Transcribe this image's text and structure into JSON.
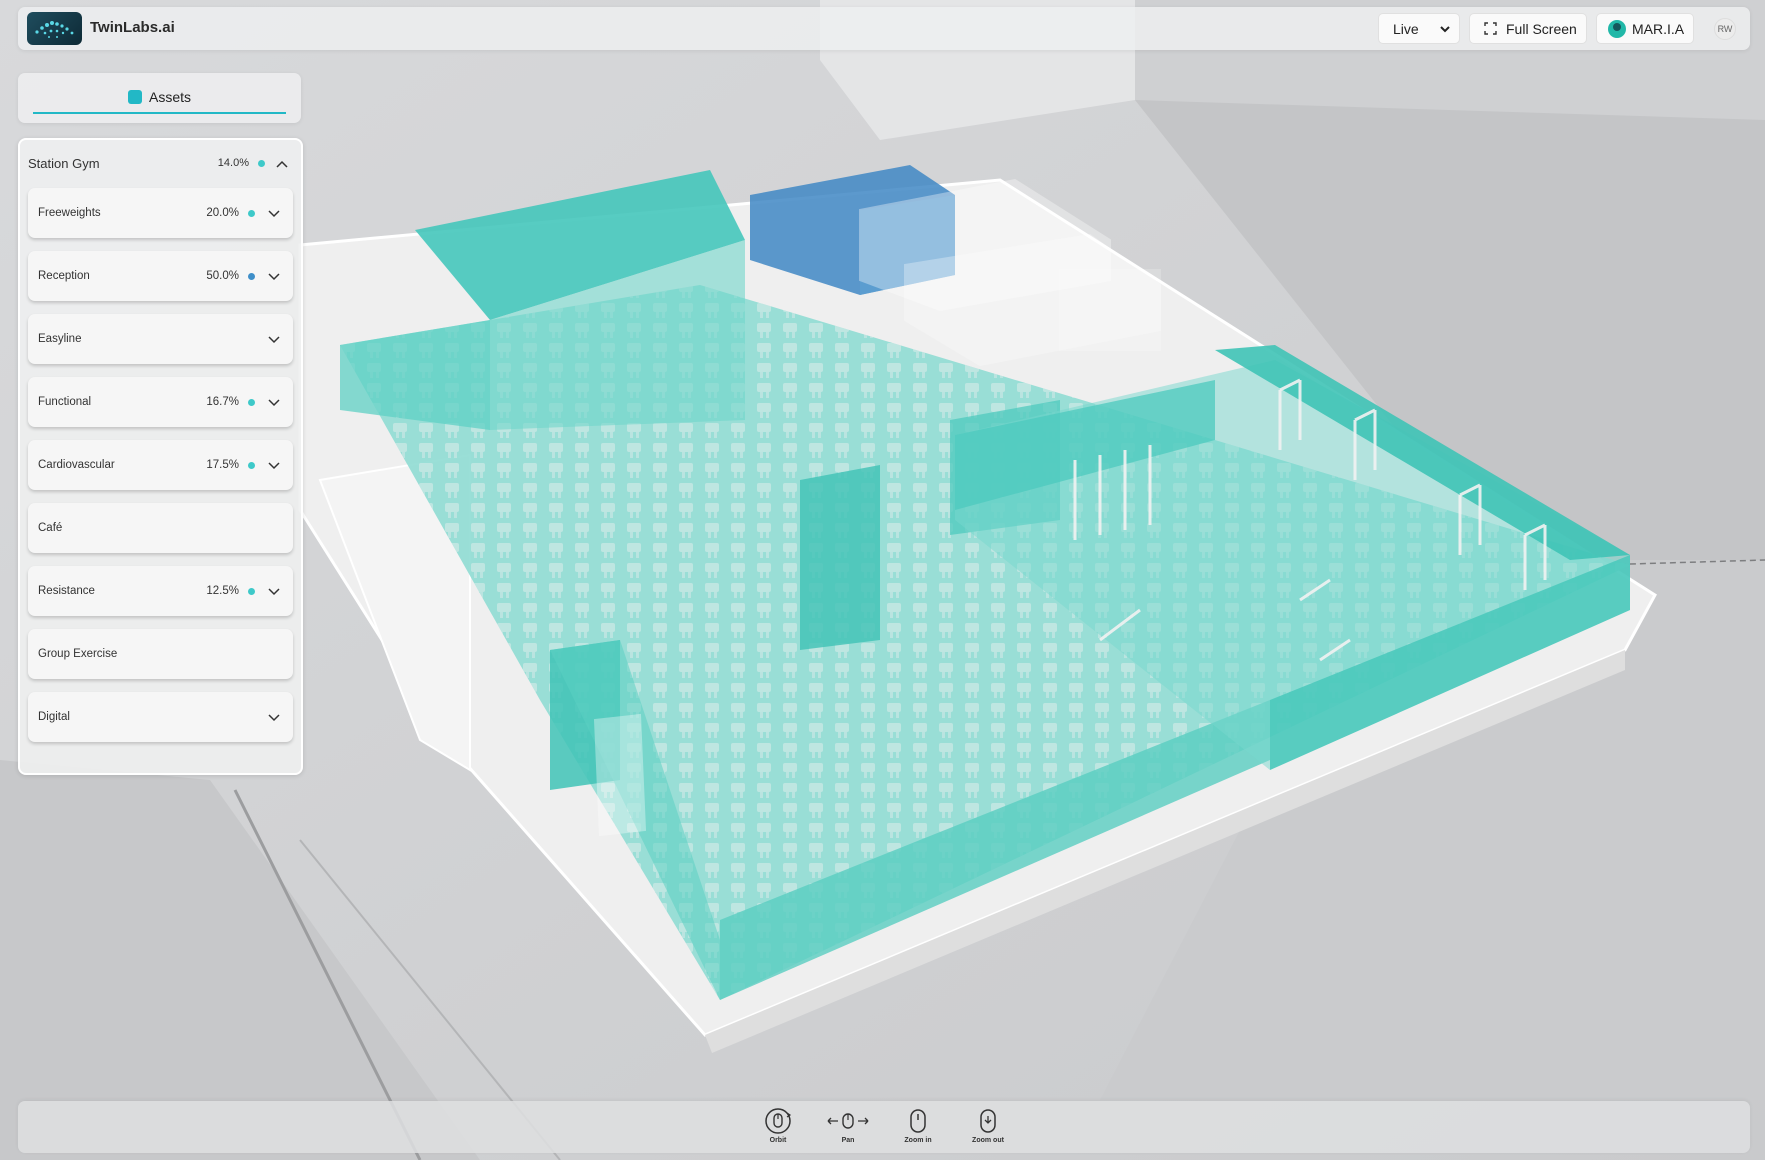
{
  "header": {
    "brand": "TwinLabs.ai",
    "view_mode": "Live",
    "fullscreen_label": "Full Screen",
    "user_label": "MAR.I.A",
    "user_initials": "RW"
  },
  "assets_tab": {
    "label": "Assets"
  },
  "panel": {
    "title": "Station Gym",
    "percent": "14.0%",
    "zones": [
      {
        "name": "Freeweights",
        "percent": "20.0%"
      },
      {
        "name": "Reception",
        "percent": "50.0%"
      },
      {
        "name": "Easyline",
        "percent": ""
      },
      {
        "name": "Functional",
        "percent": "16.7%"
      },
      {
        "name": "Cardiovascular",
        "percent": "17.5%"
      },
      {
        "name": "Café",
        "percent": ""
      },
      {
        "name": "Resistance",
        "percent": "12.5%"
      },
      {
        "name": "Group Exercise",
        "percent": ""
      },
      {
        "name": "Digital",
        "percent": ""
      }
    ]
  },
  "controls": {
    "orbit": "Orbit",
    "pan": "Pan",
    "zoom_in": "Zoom in",
    "zoom_out": "Zoom out"
  },
  "colors": {
    "teal_zone": "#4fd4c4",
    "blue_zone": "#3f87c4",
    "accent": "#22b8c6",
    "status_teal": "#3ec9c9",
    "status_blue": "#3f8fc9"
  }
}
